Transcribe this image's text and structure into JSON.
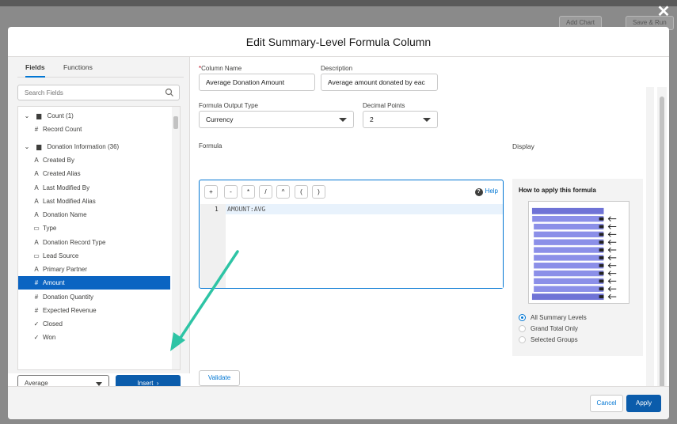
{
  "background": {
    "buttons": [
      "Add Chart",
      "Save & Run"
    ]
  },
  "modal": {
    "title": "Edit Summary-Level Formula Column"
  },
  "left_panel": {
    "tabs": [
      {
        "label": "Fields",
        "active": true
      },
      {
        "label": "Functions",
        "active": false
      }
    ],
    "search_placeholder": "Search Fields",
    "tree": [
      {
        "label": "Count (1)",
        "icon": "folder-icon",
        "group": true
      },
      {
        "label": "Record Count",
        "icon": "number-icon",
        "symbol": "#"
      },
      {
        "label": "Donation Information (36)",
        "icon": "folder-icon",
        "group": true
      },
      {
        "label": "Created By",
        "icon": "text-icon",
        "symbol": "A"
      },
      {
        "label": "Created Alias",
        "icon": "text-icon",
        "symbol": "A"
      },
      {
        "label": "Last Modified By",
        "icon": "text-icon",
        "symbol": "A"
      },
      {
        "label": "Last Modified Alias",
        "icon": "text-icon",
        "symbol": "A"
      },
      {
        "label": "Donation Name",
        "icon": "text-icon",
        "symbol": "A"
      },
      {
        "label": "Type",
        "icon": "picklist-icon",
        "symbol": "▭"
      },
      {
        "label": "Donation Record Type",
        "icon": "text-icon",
        "symbol": "A"
      },
      {
        "label": "Lead Source",
        "icon": "picklist-icon",
        "symbol": "▭"
      },
      {
        "label": "Primary Partner",
        "icon": "text-icon",
        "symbol": "A"
      },
      {
        "label": "Amount",
        "icon": "number-icon",
        "symbol": "#",
        "selected": true
      },
      {
        "label": "Donation Quantity",
        "icon": "number-icon",
        "symbol": "#"
      },
      {
        "label": "Expected Revenue",
        "icon": "number-icon",
        "symbol": "#"
      },
      {
        "label": "Closed",
        "icon": "checkbox-icon",
        "symbol": "✓"
      },
      {
        "label": "Won",
        "icon": "checkbox-icon",
        "symbol": "✓"
      }
    ],
    "aggregate_value": "Average",
    "insert_label": "Insert"
  },
  "form": {
    "column_name_label": "Column Name",
    "column_name_value": "Average Donation Amount",
    "description_label": "Description",
    "description_value": "Average amount donated by eac",
    "output_type_label": "Formula Output Type",
    "output_type_value": "Currency",
    "decimal_label": "Decimal Points",
    "decimal_value": "2",
    "formula_label": "Formula",
    "operators": [
      "+",
      "-",
      "*",
      "/",
      "^",
      "(",
      ")"
    ],
    "help_label": "Help",
    "line_number": "1",
    "code": "AMOUNT:AVG",
    "validate_label": "Validate"
  },
  "display": {
    "label": "Display",
    "how_title": "How to apply this formula",
    "options": [
      {
        "label": "All Summary Levels",
        "checked": true
      },
      {
        "label": "Grand Total Only",
        "checked": false
      },
      {
        "label": "Selected Groups",
        "checked": false
      }
    ]
  },
  "footer": {
    "cancel_label": "Cancel",
    "apply_label": "Apply"
  },
  "colors": {
    "brand": "#0b5cab",
    "accent": "#0176d3",
    "arrow": "#2ec4a5",
    "diagram_bar": "#8b8fe8"
  }
}
